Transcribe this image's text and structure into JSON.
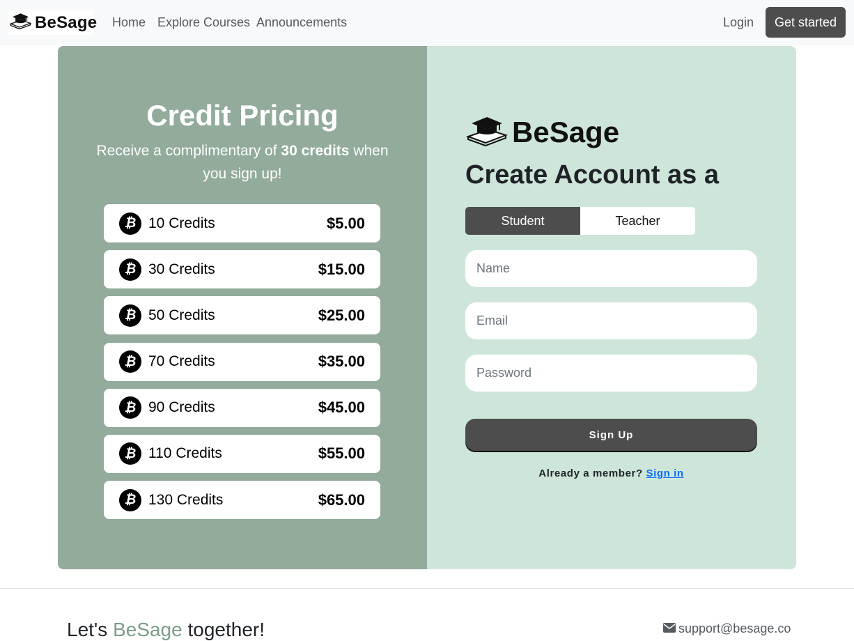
{
  "navbar": {
    "brand": "BeSage",
    "links": [
      "Home",
      "Explore Courses",
      "Announcements"
    ],
    "login": "Login",
    "cta": "Get started"
  },
  "pricing": {
    "title": "Credit Pricing",
    "subtitle_pre": "Receive a complimentary of ",
    "subtitle_bold": "30 credits",
    "subtitle_post": " when you sign up!",
    "items": [
      {
        "label": "10 Credits",
        "price": "$5.00"
      },
      {
        "label": "30 Credits",
        "price": "$15.00"
      },
      {
        "label": "50 Credits",
        "price": "$25.00"
      },
      {
        "label": "70 Credits",
        "price": "$35.00"
      },
      {
        "label": "90 Credits",
        "price": "$45.00"
      },
      {
        "label": "110 Credits",
        "price": "$55.00"
      },
      {
        "label": "130 Credits",
        "price": "$65.00"
      }
    ],
    "coin_symbol": "₿"
  },
  "signup": {
    "brand": "BeSage",
    "title": "Create Account as a",
    "roles": [
      "Student",
      "Teacher"
    ],
    "selected_role": "Student",
    "name_placeholder": "Name",
    "email_placeholder": "Email",
    "password_placeholder": "Password",
    "button": "Sign Up",
    "member_text": "Already a member?",
    "signin_link": "Sign in"
  },
  "footer": {
    "tag_pre": "Let's ",
    "tag_accent": "BeSage",
    "tag_post": " together!",
    "email": "support@besage.co"
  },
  "colors": {
    "left_panel": "#92ab9b",
    "right_panel": "#cee6da",
    "dark_button": "#4d4d4d",
    "link": "#0d6efd"
  }
}
